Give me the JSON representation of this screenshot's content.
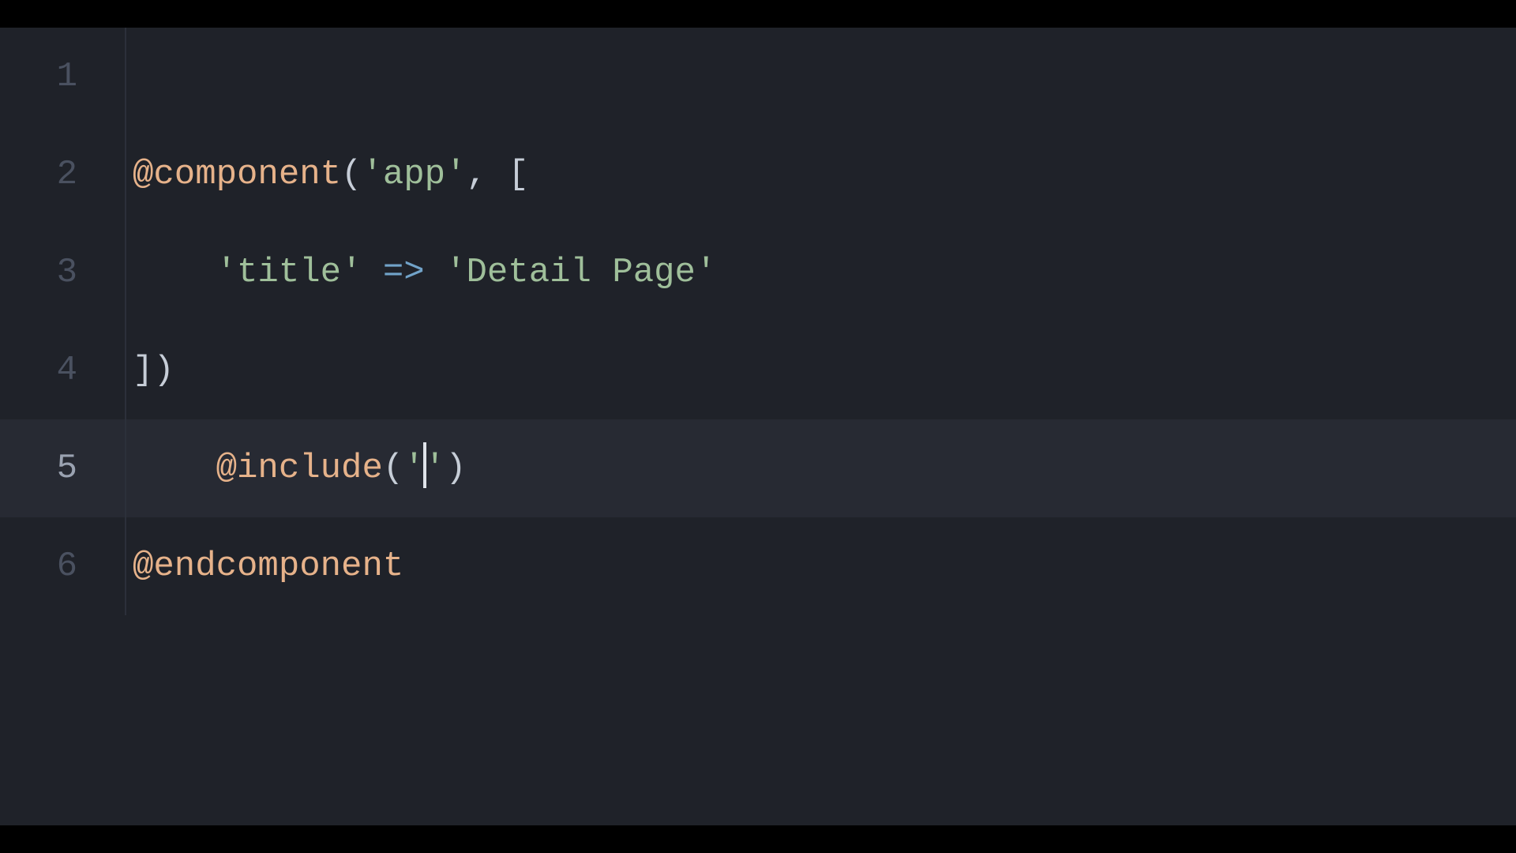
{
  "gutter": {
    "ln1": "1",
    "ln2": "2",
    "ln3": "3",
    "ln4": "4",
    "ln5": "5",
    "ln6": "6"
  },
  "code": {
    "l2": {
      "directive": "@component",
      "open": "(",
      "arg_quote_open": "'",
      "arg": "app",
      "arg_quote_close": "'",
      "comma": ", ",
      "bracket": "["
    },
    "l3": {
      "indent": "    ",
      "key_quote_open": "'",
      "key": "title",
      "key_quote_close": "'",
      "arrow": " => ",
      "val_quote_open": "'",
      "val": "Detail Page",
      "val_quote_close": "'"
    },
    "l4": {
      "close": "])"
    },
    "l5": {
      "indent": "    ",
      "directive": "@include",
      "open": "(",
      "quote_open": "'",
      "quote_close": "'",
      "close": ")"
    },
    "l6": {
      "directive": "@endcomponent"
    }
  }
}
